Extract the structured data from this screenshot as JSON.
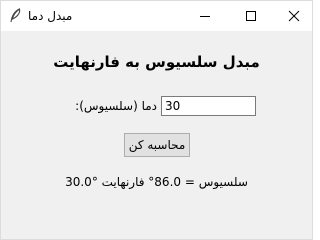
{
  "window": {
    "title": "مبدل دما",
    "icon": "feather-icon"
  },
  "titlebar_controls": {
    "minimize_icon": "minimize-icon",
    "maximize_icon": "maximize-icon",
    "close_icon": "close-icon"
  },
  "main": {
    "heading": "مبدل سلسیوس به فارنهایت",
    "temperature_label": ":دما (سلسیوس)",
    "temperature_value": "30",
    "calculate_button_label": "محاسبه کن",
    "result_text": "30.0° سلسیوس = 86.0° فارنهایت"
  }
}
